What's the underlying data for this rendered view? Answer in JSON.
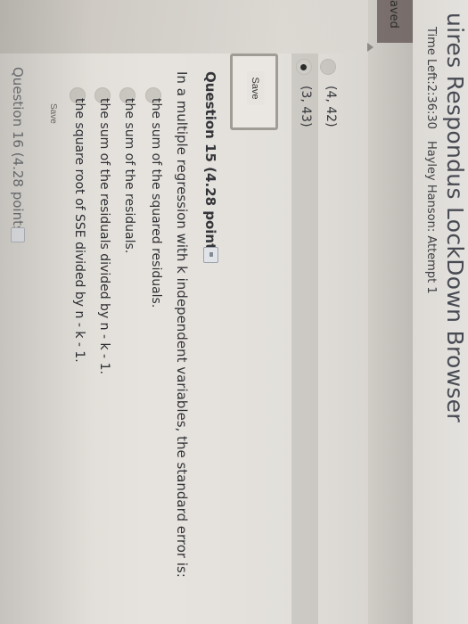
{
  "app": {
    "title": "uires Respondus LockDown Browser",
    "time_left": "Time Left:2:36:30",
    "attempt": "Hayley Hanson: Attempt 1",
    "status": "aved"
  },
  "prev_question": {
    "answers": [
      {
        "label": "(4, 42)",
        "selected": false
      },
      {
        "label": "(3, 43)",
        "selected": true
      }
    ],
    "save_label": "Save"
  },
  "question15": {
    "title": "Question 15 (4.28 points)",
    "text": "In a multiple regression with k independent variables, the standard error is:",
    "answers": [
      {
        "label": "the sum of the squared residuals."
      },
      {
        "label": "the sum of the residuals."
      },
      {
        "label": "the sum of the residuals divided by n - k - 1."
      },
      {
        "label": "the square root of SSE divided by n - k - 1."
      }
    ],
    "save_label": "Save"
  },
  "question16": {
    "title": "Question 16 (4.28 points)"
  }
}
